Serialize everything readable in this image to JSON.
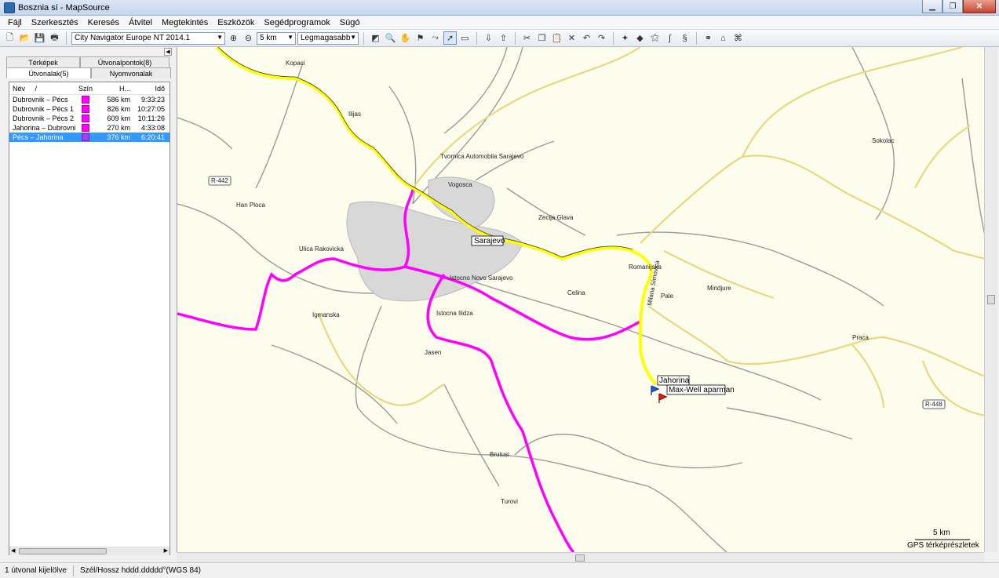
{
  "window": {
    "title": "Bosznia sí - MapSource"
  },
  "menu": [
    "Fájl",
    "Szerkesztés",
    "Keresés",
    "Átvitel",
    "Megtekintés",
    "Eszközök",
    "Segédprogramok",
    "Súgó"
  ],
  "toolbar": {
    "map_product": "City Navigator Europe NT 2014.1",
    "zoom": "5 km",
    "detail": "Legmagasabb"
  },
  "panel": {
    "tabs_top": [
      "Térképek",
      "Útvonalpontok(8)"
    ],
    "tabs_bottom": [
      "Útvonalak(5)",
      "Nyomvonalak"
    ],
    "columns": {
      "name": "Név",
      "sort": "/",
      "color": "Szín",
      "length": "H...",
      "time": "Idő"
    },
    "routes": [
      {
        "name": "Dubrovnik – Pécs",
        "color": "#ff00ff",
        "length": "586 km",
        "time": "9:33:23"
      },
      {
        "name": "Dubrovnik – Pécs 1",
        "color": "#ff00ff",
        "length": "826 km",
        "time": "10:27:05"
      },
      {
        "name": "Dubrovnik – Pécs 2",
        "color": "#ff00ff",
        "length": "609 km",
        "time": "10:11:26"
      },
      {
        "name": "Jahorina – Dubrovnik",
        "color": "#ff00ff",
        "length": "270 km",
        "time": "4:33:08"
      },
      {
        "name": "Pécs – Jahorina",
        "color": "#a040ff",
        "length": "376 km",
        "time": "6:20:41"
      }
    ]
  },
  "map": {
    "places": {
      "sarajevo": "Sarajevo",
      "jahorina": "Jahorina",
      "maxwell": "Max-Well aparman",
      "ilijas": "Ilijas",
      "vogosca": "Vogosca",
      "sokolac": "Sokolac",
      "romanijska": "Romanijska",
      "pale": "Pale",
      "istocno_novo": "Istocno Novo Sarajevo",
      "istocna_ilidza": "Istocna Ilidza",
      "ulica_rakovicka": "Ulica Rakovicka",
      "han_ploca": "Han Ploca",
      "igmanska": "Igmanska",
      "celina": "Celina",
      "zecija_glava": "Zecija Glava",
      "jasen": "Jasen",
      "tvornica": "Tvornica Automobila Sarajevo",
      "kopaci": "Kopaci",
      "praca": "Praca",
      "brutusi": "Brutusi",
      "turovi": "Turovi",
      "milana_simovica": "Milana Simovica",
      "mindjure": "Mindjure"
    },
    "road_badges": {
      "r442": "R-442",
      "r448": "R-448"
    },
    "scale": "5 km",
    "copyright": "GPS térképrészletek"
  },
  "status": {
    "selection": "1 útvonal kijelölve",
    "coords": "Szél/Hossz hddd.ddddd°(WGS 84)"
  },
  "colors": {
    "route_pink": "#ff00ff",
    "route_yellow": "#ffff00",
    "selection": "#3399ff"
  }
}
